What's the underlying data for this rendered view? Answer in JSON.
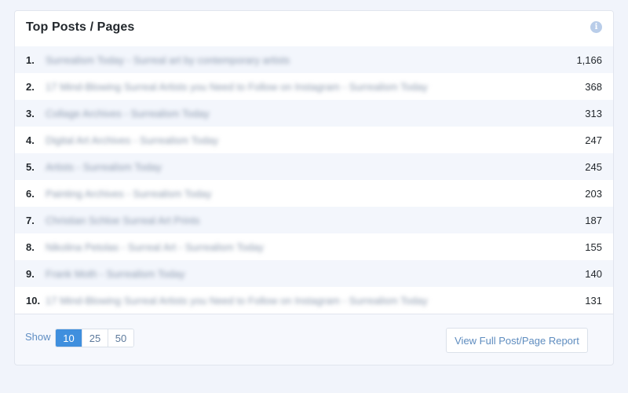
{
  "widget": {
    "title": "Top Posts / Pages",
    "info_icon": "info-circle-icon"
  },
  "rows": [
    {
      "rank": "1.",
      "title": "Surrealism Today - Surreal art by contemporary artists",
      "views": "1,166"
    },
    {
      "rank": "2.",
      "title": "17 Mind-Blowing Surreal Artists you Need to Follow on Instagram - Surrealism Today",
      "views": "368"
    },
    {
      "rank": "3.",
      "title": "Collage Archives - Surrealism Today",
      "views": "313"
    },
    {
      "rank": "4.",
      "title": "Digital Art Archives - Surrealism Today",
      "views": "247"
    },
    {
      "rank": "5.",
      "title": "Artists - Surrealism Today",
      "views": "245"
    },
    {
      "rank": "6.",
      "title": "Painting Archives - Surrealism Today",
      "views": "203"
    },
    {
      "rank": "7.",
      "title": "Christian Schloe Surreal Art Prints",
      "views": "187"
    },
    {
      "rank": "8.",
      "title": "Nikolina Petolas - Surreal Art - Surrealism Today",
      "views": "155"
    },
    {
      "rank": "9.",
      "title": "Frank Moth - Surrealism Today",
      "views": "140"
    },
    {
      "rank": "10.",
      "title": "17 Mind-Blowing Surreal Artists you Need to Follow on Instagram - Surrealism Today",
      "views": "131"
    }
  ],
  "footer": {
    "show_label": "Show",
    "show_options": [
      {
        "label": "10",
        "active": true
      },
      {
        "label": "25",
        "active": false
      },
      {
        "label": "50",
        "active": false
      }
    ],
    "report_button": "View Full Post/Page Report"
  },
  "colors": {
    "accent": "#3f8fde",
    "link": "#5e8cbf",
    "info_icon": "#b9cde9"
  }
}
